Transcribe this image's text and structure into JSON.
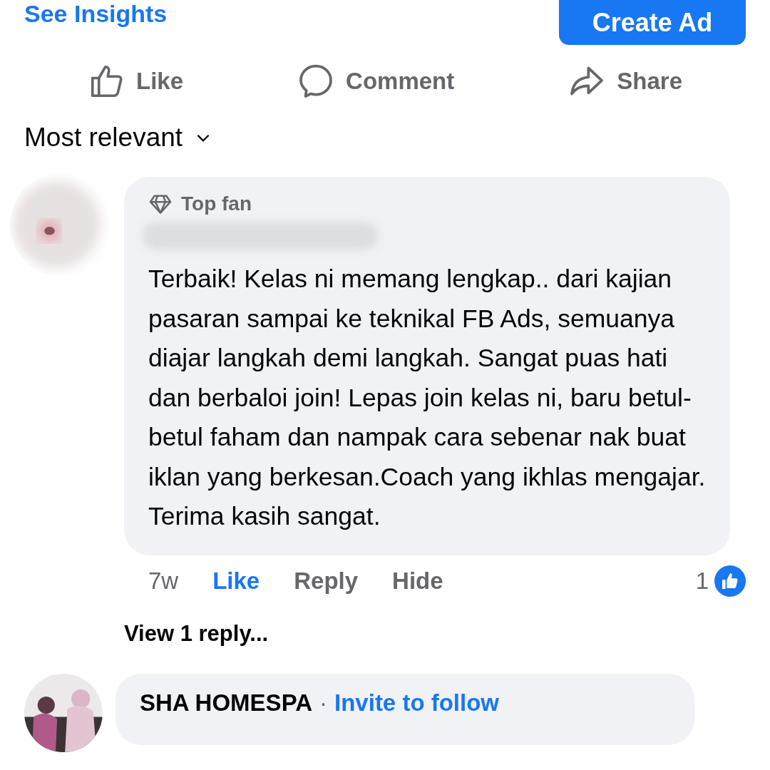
{
  "header": {
    "insights_link": "See Insights",
    "create_button": "Create Ad"
  },
  "post_actions": [
    {
      "kind": "like",
      "label": "Like"
    },
    {
      "kind": "comment",
      "label": "Comment"
    },
    {
      "kind": "share",
      "label": "Share"
    }
  ],
  "sort": {
    "label": "Most relevant"
  },
  "comments": [
    {
      "badge": "Top fan",
      "author_hidden": true,
      "text": "Terbaik! Kelas ni memang lengkap.. dari kajian pasaran sampai ke teknikal FB Ads, semuanya diajar langkah demi langkah. Sangat puas hati dan berbaloi join! Lepas join kelas ni, baru betul-betul faham dan nampak cara sebenar nak buat iklan yang berkesan.Coach yang ikhlas mengajar. Terima kasih sangat.",
      "time": "7w",
      "like_label": "Like",
      "liked": true,
      "reply_label": "Reply",
      "hide_label": "Hide",
      "reaction_count": "1",
      "view_replies": "View 1 reply..."
    },
    {
      "author": "SHA HOMESPA",
      "separator": "·",
      "follow_link": "Invite to follow"
    }
  ]
}
